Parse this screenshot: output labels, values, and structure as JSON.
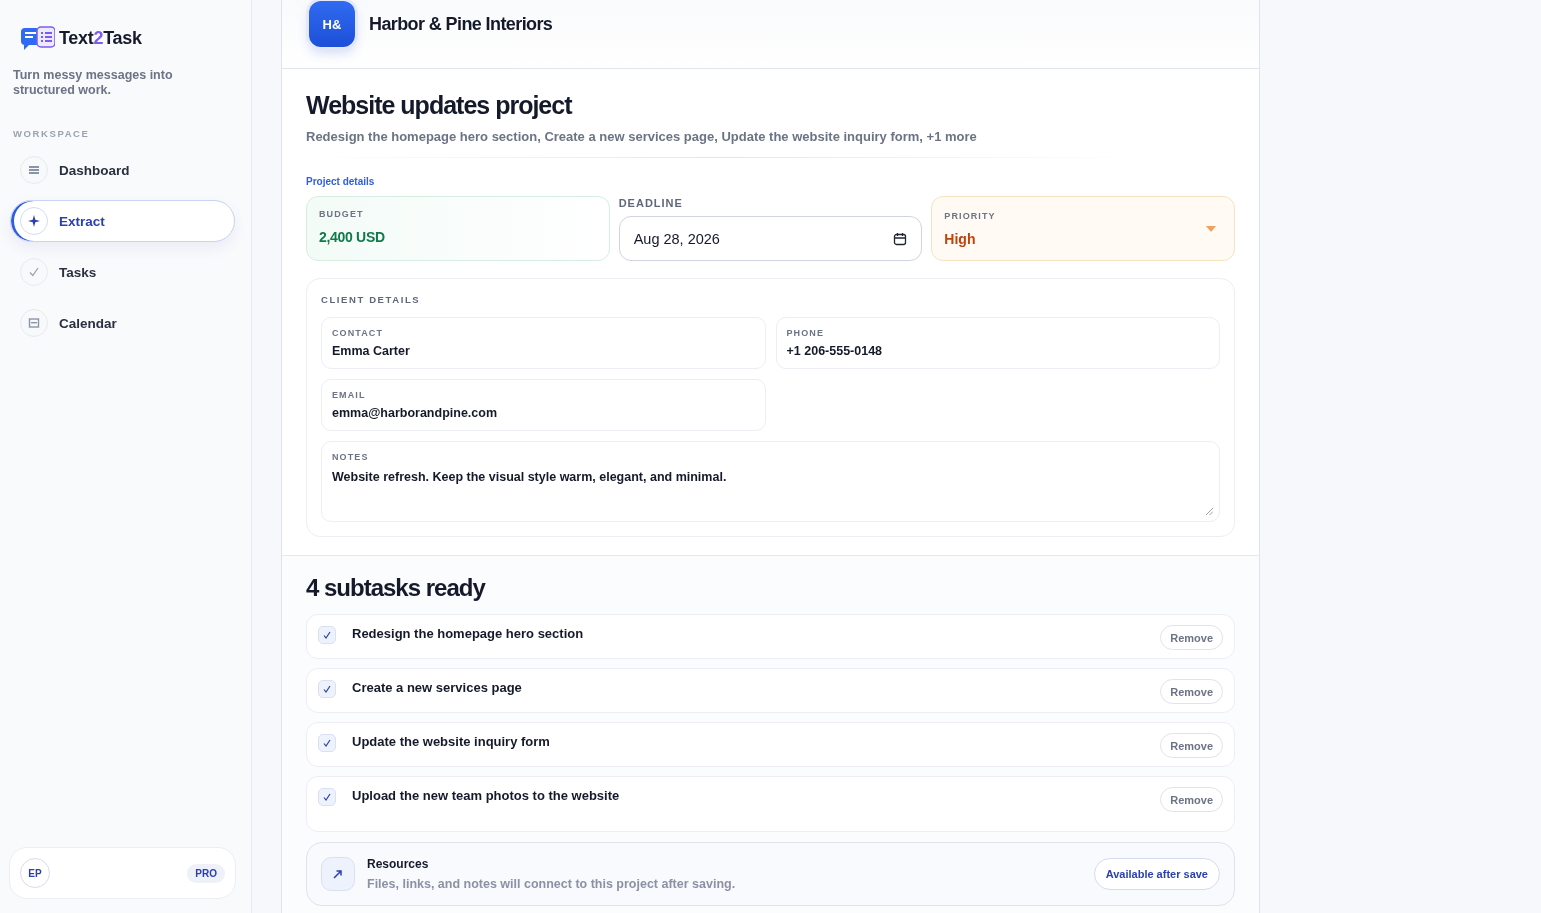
{
  "sidebar": {
    "brand": [
      {
        "text": "Text",
        "accent": false
      },
      {
        "text": "2",
        "accent": true
      },
      {
        "text": "Task",
        "accent": false
      }
    ],
    "tagline": "Turn messy messages into structured work.",
    "section_label": "WORKSPACE",
    "items": [
      {
        "label": "Dashboard",
        "kind": "list",
        "selected": false
      },
      {
        "label": "Extract",
        "kind": "sparkle",
        "selected": true
      },
      {
        "label": "Tasks",
        "kind": "check",
        "selected": false
      },
      {
        "label": "Calendar",
        "kind": "calendar",
        "selected": false
      }
    ],
    "user": {
      "initials": "EP",
      "badge": "PRO"
    }
  },
  "project": {
    "client_initials": "H&",
    "client_name": "Harbor & Pine Interiors",
    "title": "Website updates project",
    "summary": "Redesign the homepage hero section, Create a new services page, Update the website inquiry form, +1 more",
    "details_label": "Project details",
    "budget": {
      "label": "BUDGET",
      "value": "2,400 USD"
    },
    "deadline": {
      "label": "DEADLINE",
      "value": "Aug 28, 2026"
    },
    "priority": {
      "label": "PRIORITY",
      "value": "High"
    },
    "client_details": {
      "title": "CLIENT DETAILS",
      "contact": {
        "label": "CONTACT",
        "value": "Emma Carter"
      },
      "phone": {
        "label": "PHONE",
        "value": "+1 206-555-0148"
      },
      "email": {
        "label": "EMAIL",
        "value": "emma@harborandpine.com"
      },
      "notes": {
        "label": "NOTES",
        "value": "Website refresh. Keep the visual style warm, elegant, and minimal."
      }
    }
  },
  "subtasks": {
    "heading": "4 subtasks ready",
    "items": [
      {
        "title": "Redesign the homepage hero section",
        "checked": true,
        "action": "Remove"
      },
      {
        "title": "Create a new services page",
        "checked": true,
        "action": "Remove"
      },
      {
        "title": "Update the website inquiry form",
        "checked": true,
        "action": "Remove"
      },
      {
        "title": "Upload the new team photos to the website",
        "checked": true,
        "action": "Remove"
      }
    ]
  },
  "resources": {
    "title": "Resources",
    "description": "Files, links, and notes will connect to this project after saving.",
    "button": "Available after save"
  }
}
